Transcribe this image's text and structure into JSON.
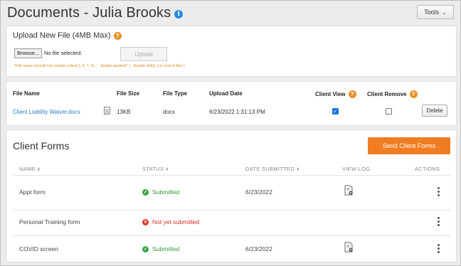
{
  "header": {
    "title": "Documents - Julia Brooks",
    "info_glyph": "i",
    "tools_label": "Tools",
    "tools_chevron": "⌄"
  },
  "upload": {
    "heading": "Upload New File (4MB Max)",
    "help_glyph": "?",
    "browse_label": "Browse...",
    "no_file_text": "No file selected.",
    "upload_label": "Upload",
    "note": "*File name should not contain colon(:), #, ?, %, ' , double quotes(\" ) , double dots(..) or end of file(.)"
  },
  "files": {
    "headers": {
      "name": "File Name",
      "size": "File Size",
      "type": "File Type",
      "date": "Upload Date",
      "client_view": "Client View",
      "client_remove": "Client Remove"
    },
    "row": {
      "name": "Client Liability Waiver.docx",
      "size": "13KB",
      "type": "docx",
      "date": "6/23/2022 1:31:13 PM",
      "client_view": true,
      "client_remove": false,
      "delete_label": "Delete"
    }
  },
  "client_forms": {
    "title": "Client Forms",
    "send_label": "Send Client Forms",
    "columns": {
      "name": "NAME",
      "status": "STATUS",
      "date": "DATE SUBMITTED",
      "viewlog": "VIEW LOG",
      "actions": "ACTIONS"
    },
    "sort_glyph": "⬍",
    "rows": [
      {
        "name": "Appt form",
        "status": "Submitted",
        "status_glyph": "✓",
        "date": "6/23/2022"
      },
      {
        "name": "Personal Training form",
        "status": "Not yet submitted",
        "status_glyph": "✕",
        "date": ""
      },
      {
        "name": "COVID screen",
        "status": "Submitted",
        "status_glyph": "✓",
        "date": "6/23/2022"
      }
    ]
  },
  "colors": {
    "accent_orange": "#f07d22",
    "link_blue": "#2a7fc8",
    "success_green": "#2f9a3a",
    "error_red": "#d42b20"
  }
}
